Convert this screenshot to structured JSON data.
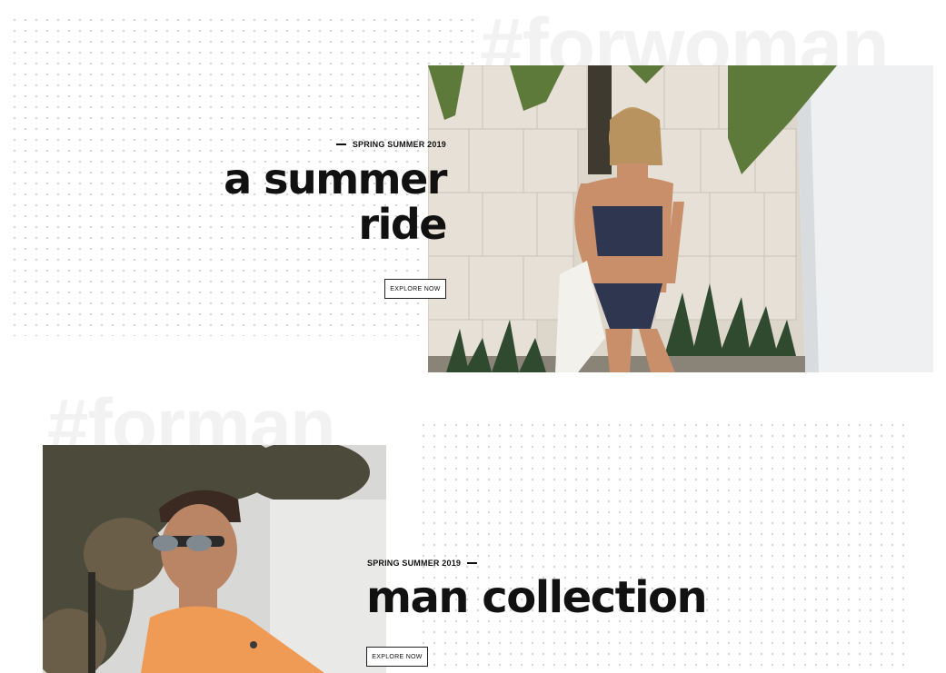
{
  "women_section": {
    "watermark": "#forwoman",
    "eyebrow": "SPRING SUMMER 2019",
    "headline_line1": "a summer",
    "headline_line2": "ride",
    "cta_label": "EXPLORE NOW"
  },
  "men_section": {
    "watermark": "#forman",
    "eyebrow": "SPRING SUMMER 2019",
    "headline": "man collection",
    "cta_label": "EXPLORE NOW"
  }
}
